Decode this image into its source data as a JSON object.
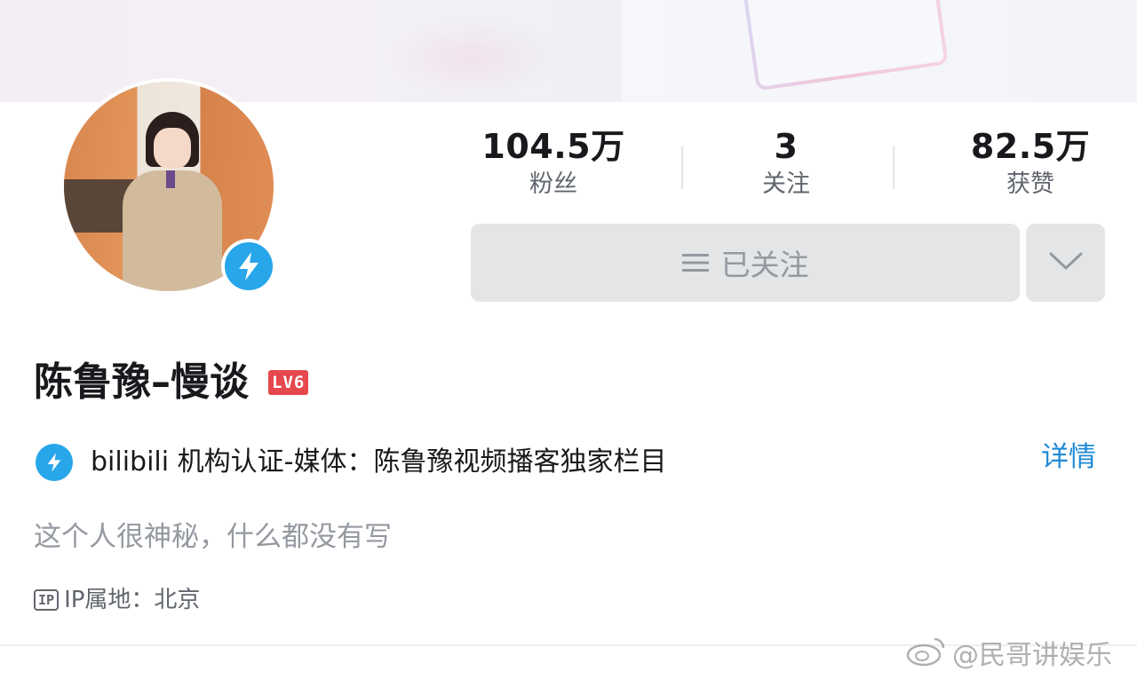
{
  "stats": {
    "fans": {
      "value": "104.5万",
      "label": "粉丝"
    },
    "following": {
      "value": "3",
      "label": "关注"
    },
    "likes": {
      "value": "82.5万",
      "label": "获赞"
    }
  },
  "actions": {
    "followed_label": "已关注"
  },
  "profile": {
    "name": "陈鲁豫–慢谈",
    "level": "LV6",
    "certification": "bilibili 机构认证-媒体：陈鲁豫视频播客独家栏目",
    "detail_link": "详情",
    "bio": "这个人很神秘，什么都没有写",
    "ip_label": "IP属地：北京",
    "ip_badge": "IP"
  },
  "watermark": "@民哥讲娱乐",
  "colors": {
    "accent_blue": "#27a6ea",
    "link_blue": "#1f8ad6",
    "level_red": "#e5484d",
    "button_gray": "#e3e5e7"
  },
  "icons": [
    "lightning-verify-icon",
    "menu-lines-icon",
    "chevron-down-icon",
    "ip-icon",
    "weibo-logo-icon"
  ]
}
